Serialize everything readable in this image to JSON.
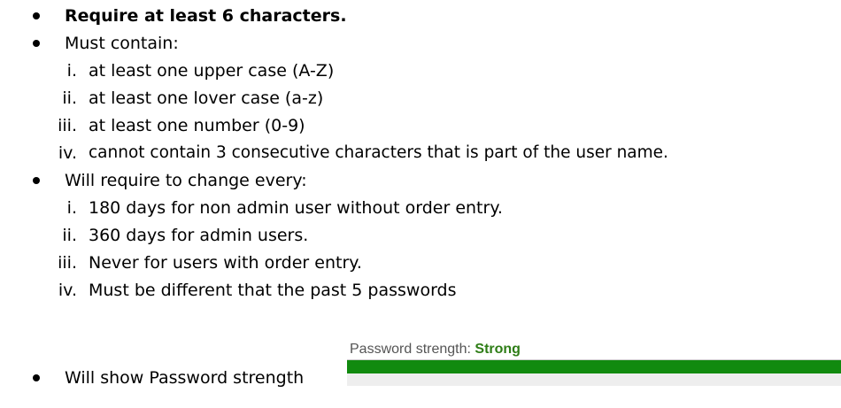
{
  "requirements": [
    {
      "text": "Require at least 6 characters.",
      "bold": true,
      "subitems": []
    },
    {
      "text": "Must contain:",
      "bold": false,
      "subitems": [
        {
          "num": "i.",
          "text": "at least one upper case (A-Z)"
        },
        {
          "num": "ii.",
          "text": "at least one lover case (a-z)"
        },
        {
          "num": "iii.",
          "text": "at least one number (0-9)"
        },
        {
          "num": "iv.",
          "text": "cannot contain 3 consecutive characters that is part of the user name."
        }
      ]
    },
    {
      "text": "Will require to change every:",
      "bold": false,
      "subitems": [
        {
          "num": "i.",
          "text": "180 days for non admin user without order entry."
        },
        {
          "num": "ii.",
          "text": "360 days for admin users."
        },
        {
          "num": "iii.",
          "text": "Never for users with order entry."
        },
        {
          "num": "iv.",
          "text": "Must be different that the past 5 passwords"
        }
      ]
    },
    {
      "text": "Will show Password strength",
      "bold": false,
      "subitems": []
    }
  ],
  "strength_widget": {
    "label": "Password strength:",
    "value": "Strong",
    "fill_fraction": 1.0,
    "fill_color": "#118a0f",
    "value_color": "#2e7d16"
  }
}
